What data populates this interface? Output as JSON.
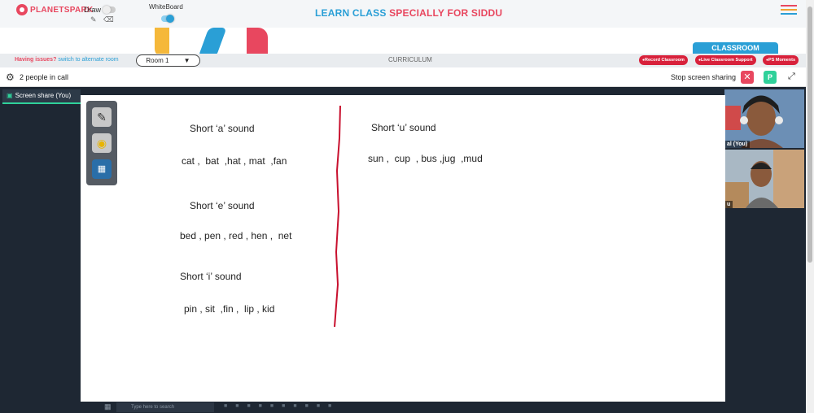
{
  "header": {
    "logo_text": "PLANETSPARK",
    "draw_label": "Draw",
    "draw_enabled": false,
    "whiteboard_label": "WhiteBoard",
    "whiteboard_enabled": true,
    "title_part1": "LEARN CLASS",
    "title_part2": "SPECIALLY FOR SIDDU",
    "colors": {
      "blue": "#2a9fd6",
      "red": "#e8475f"
    }
  },
  "classroom_tab": "CLASSROOM",
  "issue_bar": {
    "issue_text": "Having issues?",
    "alt_room_link": "switch to alternate room",
    "room_select": "Room 1",
    "curriculum_label": "CURRICULUM",
    "pills": [
      "Record Classroom",
      "Live Classroom Support",
      "PS Moments"
    ]
  },
  "call_bar": {
    "people_count": "2 people in call",
    "stop_share": "Stop screen sharing",
    "avatar_letter": "P"
  },
  "screen_share_label": "Screen share (You)",
  "whiteboard_content": {
    "a_heading": "Short ‘a’ sound",
    "a_words": "cat ,  bat  ,hat , mat  ,fan",
    "e_heading": "Short ‘e’ sound",
    "e_words": "bed , pen , red , hen ,  net",
    "i_heading": "Short ‘i’ sound",
    "i_words": "pin , sit  ,fin ,  lip , kid",
    "u_heading": "Short ‘u’ sound",
    "u_words": "sun ,  cup  , bus ,jug  ,mud"
  },
  "tools": [
    "pencil-icon",
    "eraser-icon",
    "frame-icon"
  ],
  "participants": [
    {
      "name": "al (You)"
    },
    {
      "name": "u"
    }
  ],
  "taskbar": {
    "search_placeholder": "Type here to search"
  }
}
